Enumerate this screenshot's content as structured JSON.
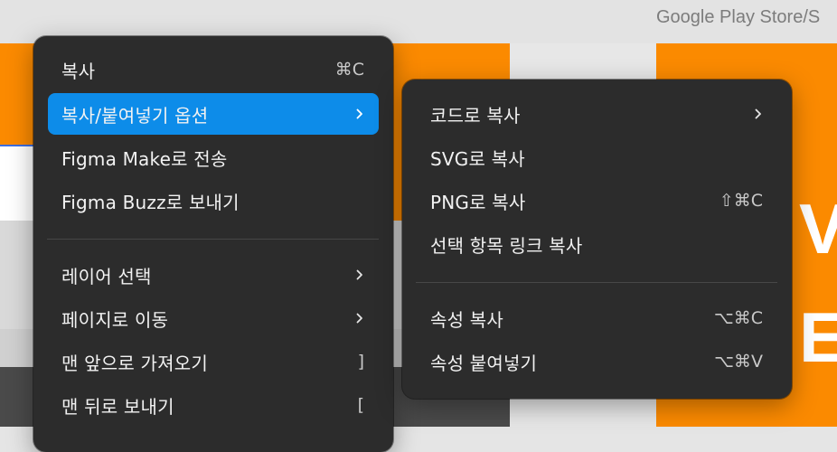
{
  "background": {
    "top_label": "Google Play Store/S",
    "big_letter_1": "V",
    "big_letter_2": "E",
    "accent_orange": "#fb8a00"
  },
  "main_menu": {
    "items": [
      {
        "label": "복사",
        "shortcut": "⌘C"
      },
      {
        "label": "복사/붙여넣기 옵션",
        "submenu": true,
        "active": true
      },
      {
        "label": "Figma Make로 전송"
      },
      {
        "label": "Figma Buzz로 보내기"
      },
      {
        "label": "레이어 선택",
        "submenu": true
      },
      {
        "label": "페이지로 이동",
        "submenu": true
      },
      {
        "label": "맨 앞으로 가져오기",
        "shortcut": "]"
      },
      {
        "label": "맨 뒤로 보내기",
        "shortcut": "["
      }
    ]
  },
  "sub_menu": {
    "items": [
      {
        "label": "코드로 복사",
        "submenu": true
      },
      {
        "label": "SVG로 복사"
      },
      {
        "label": "PNG로 복사",
        "shortcut": "⇧⌘C"
      },
      {
        "label": "선택 항목 링크 복사"
      },
      {
        "label": "속성 복사",
        "shortcut": "⌥⌘C"
      },
      {
        "label": "속성 붙여넣기",
        "shortcut": "⌥⌘V"
      }
    ]
  },
  "colors": {
    "menu_bg": "#2c2c2c",
    "highlight": "#0d8ce9",
    "text": "#f2f2f2"
  }
}
